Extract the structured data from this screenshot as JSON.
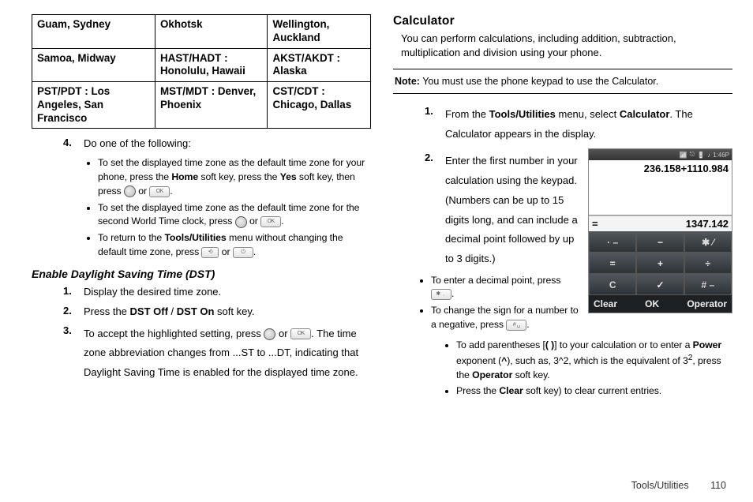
{
  "timezone_table": {
    "rows": [
      [
        "Guam, Sydney",
        "Okhotsk",
        "Wellington, Auckland"
      ],
      [
        "Samoa, Midway",
        "HAST/HADT : Honolulu, Hawaii",
        "AKST/AKDT : Alaska"
      ],
      [
        "PST/PDT : Los Angeles, San Francisco",
        "MST/MDT : Denver, Phoenix",
        "CST/CDT : Chicago, Dallas"
      ]
    ]
  },
  "left": {
    "step4_num": "4.",
    "step4_text": "Do one of the following:",
    "bullets": {
      "b1_a": "To set the displayed time zone as the default time zone for your phone, press the ",
      "b1_home": "Home",
      "b1_b": " soft key, press the ",
      "b1_yes": "Yes",
      "b1_c": " soft key, then press ",
      "b1_or": " or ",
      "b1_end": ".",
      "b2_a": "To set the displayed time zone as the default time zone for the second  World Time clock, press ",
      "b2_or": " or ",
      "b2_end": ".",
      "b3_a": "To return to the ",
      "b3_tools": "Tools/Utilities",
      "b3_b": " menu without changing the default time zone, press ",
      "b3_or": " or ",
      "b3_end": "."
    },
    "dst_heading": "Enable Daylight Saving Time (DST)",
    "dst_steps": {
      "s1_num": "1.",
      "s1": "Display the desired time zone.",
      "s2_num": "2.",
      "s2_a": "Press the ",
      "s2_off": "DST Off",
      "s2_slash": " / ",
      "s2_on": "DST On",
      "s2_b": " soft key.",
      "s3_num": "3.",
      "s3_a": "To accept the highlighted setting, press ",
      "s3_or": " or ",
      "s3_b": ". The time zone abbreviation changes from ...ST to ...DT, indicating that Daylight Saving Time is enabled for the displayed time zone."
    }
  },
  "right": {
    "heading": "Calculator",
    "intro": "You can perform calculations, including addition, subtraction, multiplication and division using your phone.",
    "note_label": "Note:",
    "note_text": " You must use the phone keypad to use the Calculator.",
    "s1_num": "1.",
    "s1_a": "From the ",
    "s1_tools": "Tools/Utilities",
    "s1_b": " menu, select ",
    "s1_calc": "Calculator",
    "s1_c": ". The Calculator appears in the display.",
    "s2_num": "2.",
    "s2": "Enter the first number in your calculation using the keypad. (Numbers can be up to 15 digits long, and can include a decimal point followed by up to 3 digits.)",
    "bul": {
      "dp_a": "To enter a decimal point, press ",
      "dp_b": ".",
      "neg_a": "To change the sign for a number to a negative, press ",
      "neg_b": ".",
      "par_a": "To add parentheses [",
      "par_paren": "( )",
      "par_b": "] to your calculation or to enter a ",
      "par_pow": "Power",
      "par_c": " exponent (",
      "par_caret": "^",
      "par_d": "), such as, 3^2, which is the equivalent of 3",
      "par_sup": "2",
      "par_e": ", press the ",
      "par_op": "Operator",
      "par_f": " soft key.",
      "clr_a": "Press the ",
      "clr_b": "Clear",
      "clr_c": " soft key) to clear current entries."
    }
  },
  "phone": {
    "time": "1:46P",
    "expr": "236.158+1110.984",
    "eq": "=",
    "result": "1347.142",
    "keys": {
      "dot": "·  –",
      "minus": "−",
      "star": "✱  ⁄",
      "left": "=",
      "plus": "+",
      "right": "÷",
      "c": "C",
      "check": "✓",
      "hash": "#  –"
    },
    "soft_left": "Clear",
    "soft_mid": "OK",
    "soft_right": "Operator"
  },
  "footer": {
    "section": "Tools/Utilities",
    "page": "110"
  }
}
